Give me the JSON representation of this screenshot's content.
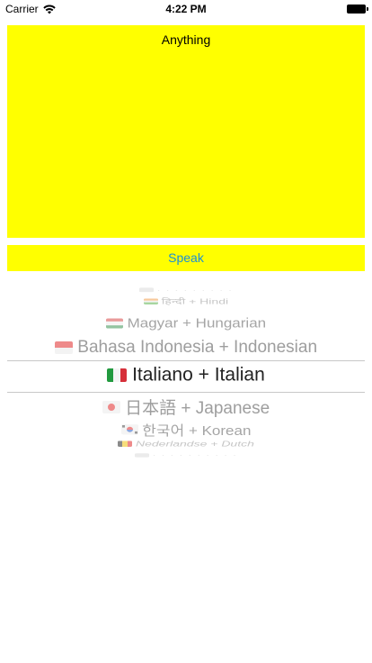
{
  "status_bar": {
    "carrier": "Carrier",
    "time": "4:22 PM",
    "wifi_icon": "wifi-icon",
    "battery_icon": "battery-full-icon"
  },
  "text_view": {
    "text": "Anything",
    "background": "#ffff00"
  },
  "speak_button": {
    "label": "Speak",
    "background": "#ffff00",
    "text_color": "#1a8fd6"
  },
  "language_picker": {
    "items": [
      {
        "label": "हिन्दी + Hindi",
        "flag": "india-flag-icon"
      },
      {
        "label": "Magyar + Hungarian",
        "flag": "hungary-flag-icon"
      },
      {
        "label": "Bahasa Indonesia + Indonesian",
        "flag": "indonesia-flag-icon"
      },
      {
        "label": "Italiano + Italian",
        "flag": "italy-flag-icon",
        "selected": true
      },
      {
        "label": "日本語 + Japanese",
        "flag": "japan-flag-icon"
      },
      {
        "label": "한국어 + Korean",
        "flag": "south-korea-flag-icon"
      },
      {
        "label": "Nederlandse + Dutch",
        "flag": "belgium-flag-icon"
      }
    ]
  }
}
